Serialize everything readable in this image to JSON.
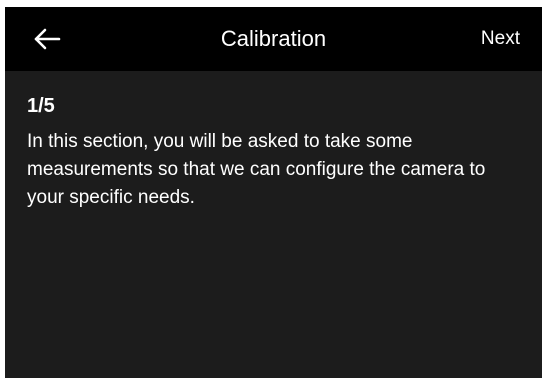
{
  "header": {
    "back_icon": "arrow-left-icon",
    "title": "Calibration",
    "next_label": "Next"
  },
  "content": {
    "step": "1/5",
    "description": "In this section, you will be asked to take some measurements so that we can configure the camera to your specific needs."
  },
  "colors": {
    "header_background": "#000000",
    "screen_background": "#1c1c1c",
    "text": "#ffffff"
  }
}
